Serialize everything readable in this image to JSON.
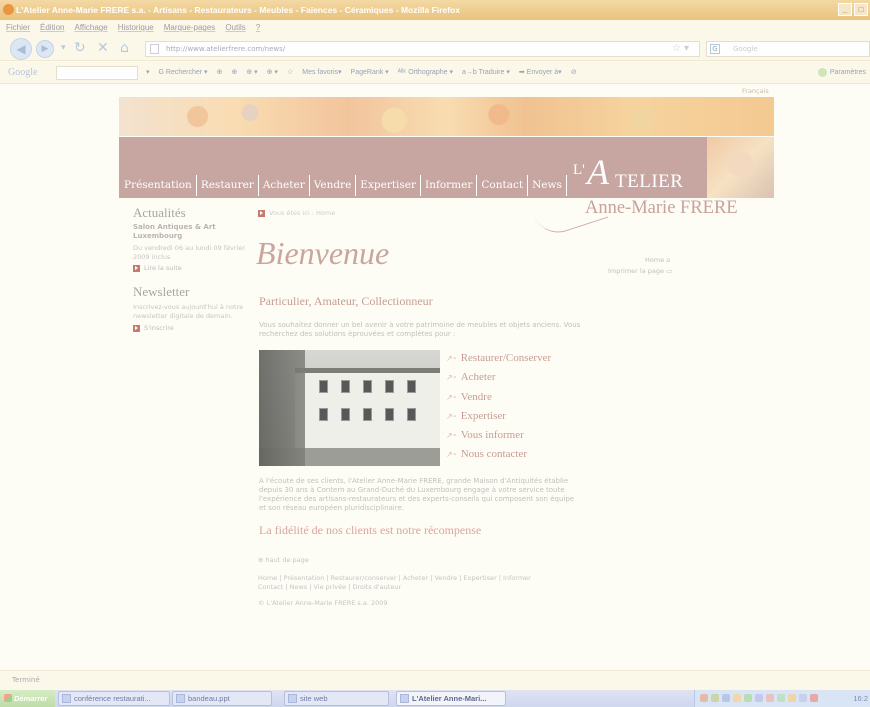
{
  "browser": {
    "title": "L'Atelier Anne-Marie FRERE s.a. - Artisans - Restaurateurs - Meubles - Faïences - Céramiques - Mozilla Firefox",
    "menu": [
      "Fichier",
      "Édition",
      "Affichage",
      "Historique",
      "Marque-pages",
      "Outils",
      "?"
    ],
    "url": "http://www.atelierfrere.com/news/",
    "search_placeholder": "Google",
    "status": "Terminé",
    "window_buttons": [
      "_",
      "□"
    ]
  },
  "google_toolbar": {
    "logo": "Google",
    "items": [
      "▾",
      "G Rechercher ▾",
      "⊕",
      "⊕",
      "⊕ ▾",
      "⊕ ▾",
      "☆",
      "Mes favoris▾",
      "PageRank ▾",
      "ᴬᴮᶜ Orthographe ▾",
      "a→b Traduire ▾",
      "➡ Envoyer à▾",
      "⊘"
    ],
    "settings": "Paramètres"
  },
  "site": {
    "language": "Français",
    "nav": [
      "Présentation",
      "Restaurer",
      "Acheter",
      "Vendre",
      "Expertiser",
      "Informer",
      "Contact",
      "News"
    ],
    "brand": {
      "l": "L'",
      "a": "A",
      "atelier": "TELIER",
      "name": "Anne-Marie FRERE"
    },
    "sidebar": {
      "actualites_title": "Actualités",
      "actualites_headline": "Salon Antiques & Art Luxembourg",
      "actualites_date": "Du vendredi 06 au lundi 09 février 2009 inclus",
      "read_more": "Lire la suite",
      "newsletter_title": "Newsletter",
      "newsletter_text": "Inscrivez-vous aujourd'hui à notre newsletter digitale de demain.",
      "subscribe": "S'inscrire"
    },
    "main": {
      "breadcrumb": "Vous êtes ici : Home",
      "welcome": "Bienvenue",
      "home_link": "Home",
      "print_link": "Imprimer la page",
      "subtitle": "Particulier, Amateur, Collectionneur",
      "intro": "Vous souhaitez donner un bel avenir à votre patrimoine de meubles et objets anciens. Vous recherchez des solutions éprouvées et complètes pour :",
      "links": [
        "Restaurer/Conserver",
        "Acheter",
        "Vendre",
        "Expertiser",
        "Vous informer",
        "Nous contacter"
      ],
      "about": "A l'écoute de ses clients, l'Atelier Anne-Marie FRERE, grande Maison d'Antiquités établie depuis 30 ans à Contern au Grand-Duché du Luxembourg engage à votre service toute l'expérience des artisans-restaurateurs et des experts-conseils qui composent son équipe et son réseau européen pluridisciplinaire.",
      "slogan": "La fidélité de nos clients est notre récompense",
      "top_of_page": "haut de page",
      "footer_links": "Home | Présentation | Restaurer/conserver | Acheter | Vendre | Expertiser | Informer Contact | News | Vie privée | Droits d'auteur",
      "copyright": "© L'Atelier Anne-Marie FRERE s.a. 2009"
    }
  },
  "taskbar": {
    "start": "Démarrer",
    "tasks": [
      "conférence restaurati...",
      "bandeau.ppt",
      "site web",
      "L'Atelier Anne-Mari..."
    ],
    "clock": "16:2"
  }
}
